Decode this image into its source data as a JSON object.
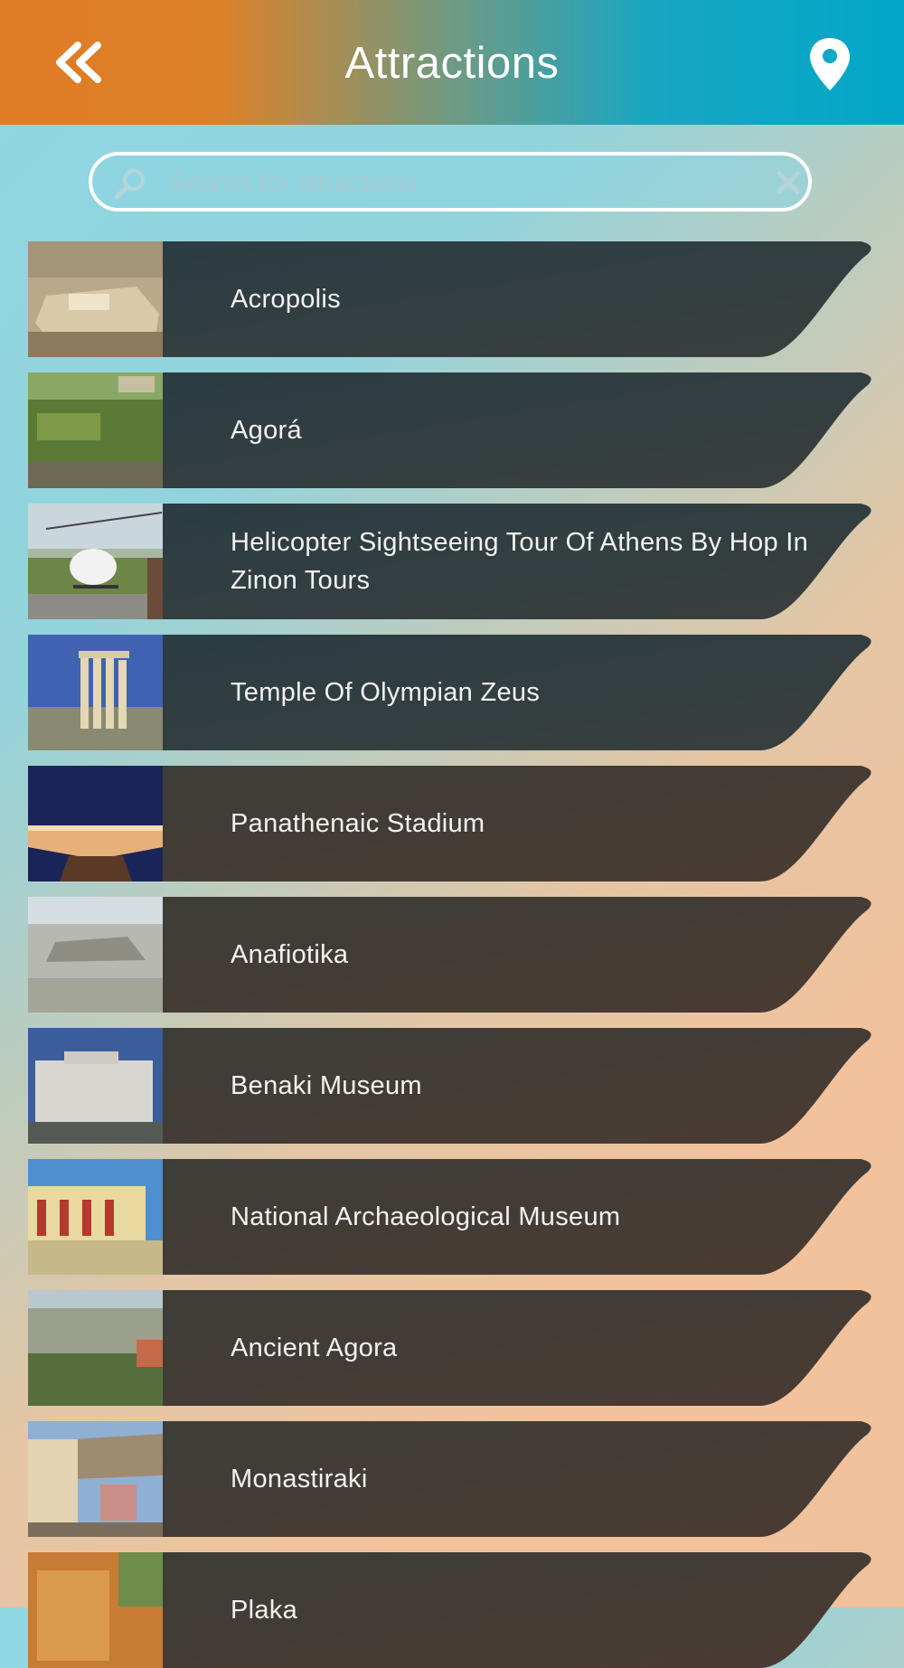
{
  "header": {
    "title": "Attractions",
    "back_icon": "double-chevron-left-icon",
    "location_icon": "map-pin-icon"
  },
  "search": {
    "placeholder": "Search for attractions",
    "value": ""
  },
  "attractions": [
    {
      "name": "Acropolis"
    },
    {
      "name": "Agorá"
    },
    {
      "name": "Helicopter Sightseeing Tour Of Athens By Hop In Zinon Tours"
    },
    {
      "name": "Temple Of Olympian Zeus"
    },
    {
      "name": "Panathenaic Stadium"
    },
    {
      "name": "Anafiotika"
    },
    {
      "name": "Benaki Museum"
    },
    {
      "name": "National Archaeological Museum"
    },
    {
      "name": "Ancient Agora"
    },
    {
      "name": "Monastiraki"
    },
    {
      "name": "Plaka"
    }
  ],
  "colors": {
    "header_left": "#e07b25",
    "header_right": "#02a6c8",
    "banner_top": "#2b3d43",
    "banner_bottom": "#4a3b33",
    "label_text": "#f3f3f3"
  }
}
